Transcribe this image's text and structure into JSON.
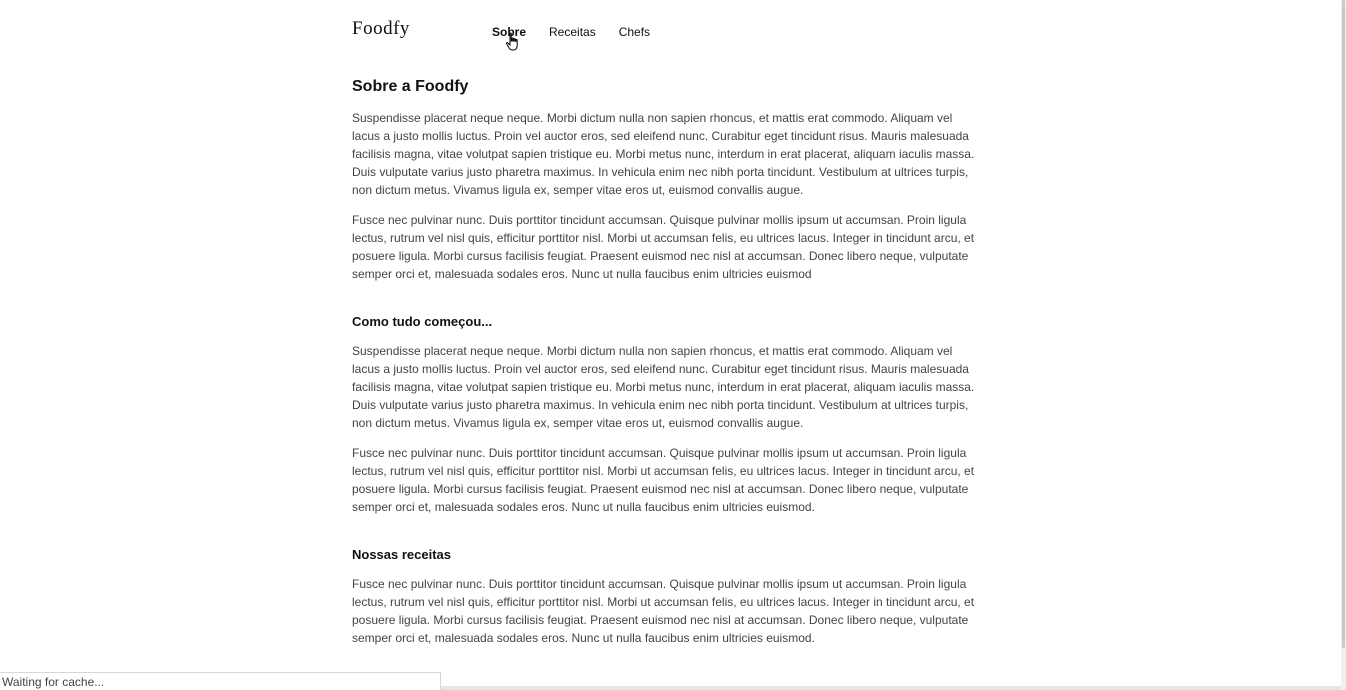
{
  "header": {
    "logo": "Foodfy",
    "nav": [
      {
        "label": "Sobre",
        "active": true
      },
      {
        "label": "Receitas",
        "active": false
      },
      {
        "label": "Chefs",
        "active": false
      }
    ]
  },
  "main": {
    "title": "Sobre a Foodfy",
    "intro_paragraphs": [
      "Suspendisse placerat neque neque. Morbi dictum nulla non sapien rhoncus, et mattis erat commodo. Aliquam vel lacus a justo mollis luctus. Proin vel auctor eros, sed eleifend nunc. Curabitur eget tincidunt risus. Mauris malesuada facilisis magna, vitae volutpat sapien tristique eu. Morbi metus nunc, interdum in erat placerat, aliquam iaculis massa. Duis vulputate varius justo pharetra maximus. In vehicula enim nec nibh porta tincidunt. Vestibulum at ultrices turpis, non dictum metus. Vivamus ligula ex, semper vitae eros ut, euismod convallis augue.",
      "Fusce nec pulvinar nunc. Duis porttitor tincidunt accumsan. Quisque pulvinar mollis ipsum ut accumsan. Proin ligula lectus, rutrum vel nisl quis, efficitur porttitor nisl. Morbi ut accumsan felis, eu ultrices lacus. Integer in tincidunt arcu, et posuere ligula. Morbi cursus facilisis feugiat. Praesent euismod nec nisl at accumsan. Donec libero neque, vulputate semper orci et, malesuada sodales eros. Nunc ut nulla faucibus enim ultricies euismod"
    ],
    "section_history": {
      "heading": "Como tudo começou...",
      "paragraphs": [
        "Suspendisse placerat neque neque. Morbi dictum nulla non sapien rhoncus, et mattis erat commodo. Aliquam vel lacus a justo mollis luctus. Proin vel auctor eros, sed eleifend nunc. Curabitur eget tincidunt risus. Mauris malesuada facilisis magna, vitae volutpat sapien tristique eu. Morbi metus nunc, interdum in erat placerat, aliquam iaculis massa. Duis vulputate varius justo pharetra maximus. In vehicula enim nec nibh porta tincidunt. Vestibulum at ultrices turpis, non dictum metus. Vivamus ligula ex, semper vitae eros ut, euismod convallis augue.",
        "Fusce nec pulvinar nunc. Duis porttitor tincidunt accumsan. Quisque pulvinar mollis ipsum ut accumsan. Proin ligula lectus, rutrum vel nisl quis, efficitur porttitor nisl. Morbi ut accumsan felis, eu ultrices lacus. Integer in tincidunt arcu, et posuere ligula. Morbi cursus facilisis feugiat. Praesent euismod nec nisl at accumsan. Donec libero neque, vulputate semper orci et, malesuada sodales eros. Nunc ut nulla faucibus enim ultricies euismod."
      ]
    },
    "section_recipes": {
      "heading": "Nossas receitas",
      "paragraphs": [
        "Fusce nec pulvinar nunc. Duis porttitor tincidunt accumsan. Quisque pulvinar mollis ipsum ut accumsan. Proin ligula lectus, rutrum vel nisl quis, efficitur porttitor nisl. Morbi ut accumsan felis, eu ultrices lacus. Integer in tincidunt arcu, et posuere ligula. Morbi cursus facilisis feugiat. Praesent euismod nec nisl at accumsan. Donec libero neque, vulputate semper orci et, malesuada sodales eros. Nunc ut nulla faucibus enim ultricies euismod."
      ]
    }
  },
  "status_bar": {
    "text": "Waiting for cache..."
  },
  "cursor": {
    "icon": "hand-pointer-icon"
  }
}
